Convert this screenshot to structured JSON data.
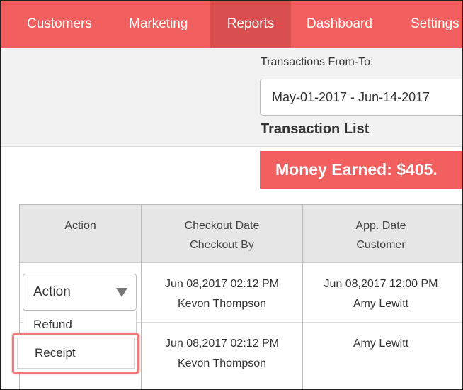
{
  "nav": {
    "items": [
      {
        "label": "Customers"
      },
      {
        "label": "Marketing"
      },
      {
        "label": "Reports"
      },
      {
        "label": "Dashboard"
      },
      {
        "label": "Settings"
      }
    ],
    "active": "Reports"
  },
  "filter": {
    "label": "Transactions From-To:",
    "date_range": "May-01-2017 - Jun-14-2017"
  },
  "list_title": "Transaction List",
  "money": {
    "label": "Money Earned:",
    "value": "$405."
  },
  "table": {
    "headers": {
      "action": "Action",
      "checkout_line1": "Checkout Date",
      "checkout_line2": "Checkout By",
      "app_line1": "App. Date",
      "app_line2": "Customer"
    },
    "rows": [
      {
        "checkout_date": "Jun 08,2017 02:12 PM",
        "checkout_by": "Kevon Thompson",
        "app_date": "Jun 08,2017 12:00 PM",
        "customer": "Amy Lewitt"
      },
      {
        "checkout_date": "Jun 08,2017 02:12 PM",
        "checkout_by": "Kevon Thompson",
        "app_date": "",
        "customer": "Amy Lewitt"
      }
    ]
  },
  "action_dropdown": {
    "selected": "Action",
    "options": [
      "Refund",
      "Receipt"
    ],
    "highlighted": "Receipt"
  },
  "colors": {
    "brand": "#f25f5f",
    "nav_active": "#d94e4f",
    "highlight": "#f07a7a"
  },
  "icons": {
    "dropdown_caret": "caret-down-icon"
  }
}
